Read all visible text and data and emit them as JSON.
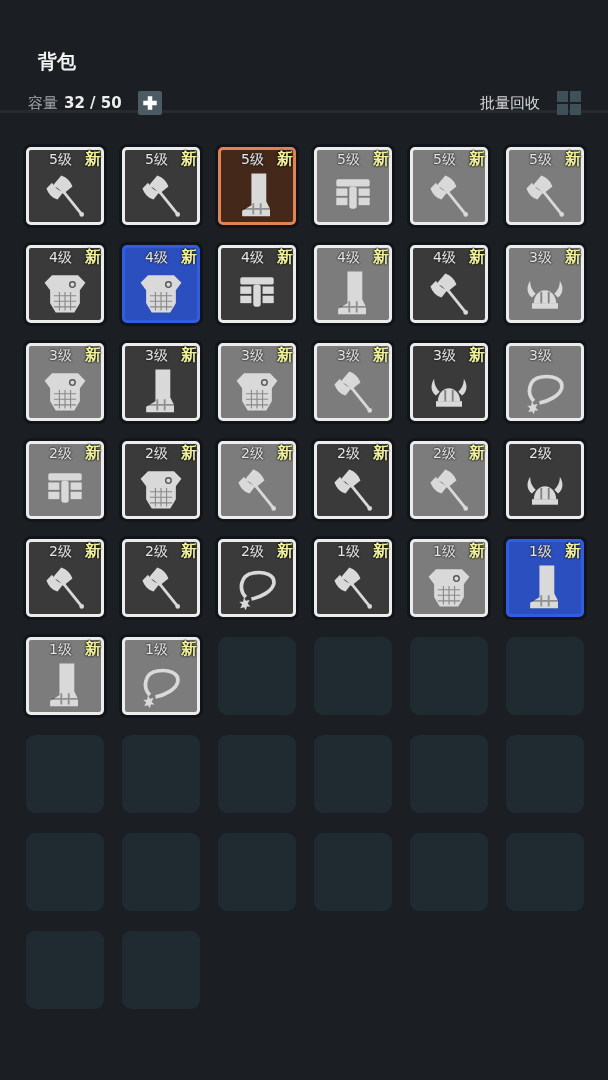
{
  "title": "背包",
  "capacity": {
    "label": "容量",
    "value": "32 / 50"
  },
  "batch_recycle": {
    "label": "批量回收"
  },
  "slots": [
    {
      "kind": "axe",
      "level": "5级",
      "badge": "新",
      "color": "#3a3a3b"
    },
    {
      "kind": "axe",
      "level": "5级",
      "badge": "新",
      "color": "#3a3a3b"
    },
    {
      "kind": "boot",
      "level": "5级",
      "badge": "新",
      "color": "#44281a"
    },
    {
      "kind": "greaves",
      "level": "5级",
      "badge": "新",
      "color": "#7c7c7c"
    },
    {
      "kind": "axe",
      "level": "5级",
      "badge": "新",
      "color": "#7c7c7c"
    },
    {
      "kind": "axe",
      "level": "5级",
      "badge": "新",
      "color": "#7c7c7c"
    },
    {
      "kind": "armor",
      "level": "4级",
      "badge": "新",
      "color": "#3a3a3b"
    },
    {
      "kind": "armor",
      "level": "4级",
      "badge": "新",
      "color": "#2b4fbe"
    },
    {
      "kind": "greaves",
      "level": "4级",
      "badge": "新",
      "color": "#3a3a3b"
    },
    {
      "kind": "boot",
      "level": "4级",
      "badge": "新",
      "color": "#7c7c7c"
    },
    {
      "kind": "axe",
      "level": "4级",
      "badge": "新",
      "color": "#3a3a3b"
    },
    {
      "kind": "helmet",
      "level": "3级",
      "badge": "新",
      "color": "#7c7c7c"
    },
    {
      "kind": "armor",
      "level": "3级",
      "badge": "新",
      "color": "#7c7c7c"
    },
    {
      "kind": "boot",
      "level": "3级",
      "badge": "新",
      "color": "#3a3a3b"
    },
    {
      "kind": "armor",
      "level": "3级",
      "badge": "新",
      "color": "#7c7c7c"
    },
    {
      "kind": "axe",
      "level": "3级",
      "badge": "新",
      "color": "#7c7c7c"
    },
    {
      "kind": "helmet",
      "level": "3级",
      "badge": "新",
      "color": "#3a3a3b"
    },
    {
      "kind": "necklace",
      "level": "3级",
      "color": "#7c7c7c"
    },
    {
      "kind": "greaves",
      "level": "2级",
      "badge": "新",
      "color": "#7c7c7c"
    },
    {
      "kind": "armor",
      "level": "2级",
      "badge": "新",
      "color": "#3a3a3b"
    },
    {
      "kind": "axe",
      "level": "2级",
      "badge": "新",
      "color": "#7c7c7c"
    },
    {
      "kind": "axe",
      "level": "2级",
      "badge": "新",
      "color": "#3a3a3b"
    },
    {
      "kind": "axe",
      "level": "2级",
      "badge": "新",
      "color": "#7c7c7c"
    },
    {
      "kind": "helmet",
      "level": "2级",
      "color": "#3a3a3b"
    },
    {
      "kind": "axe",
      "level": "2级",
      "badge": "新",
      "color": "#3a3a3b"
    },
    {
      "kind": "axe",
      "level": "2级",
      "badge": "新",
      "color": "#3a3a3b"
    },
    {
      "kind": "necklace",
      "level": "2级",
      "badge": "新",
      "color": "#3a3a3b"
    },
    {
      "kind": "axe",
      "level": "1级",
      "badge": "新",
      "color": "#3a3a3b"
    },
    {
      "kind": "armor",
      "level": "1级",
      "badge": "新",
      "color": "#7c7c7c"
    },
    {
      "kind": "boot",
      "level": "1级",
      "badge": "新",
      "color": "#2b4fbe"
    },
    {
      "kind": "boot",
      "level": "1级",
      "badge": "新",
      "color": "#7c7c7c"
    },
    {
      "kind": "necklace",
      "level": "1级",
      "badge": "新",
      "color": "#7c7c7c"
    },
    {
      "kind": "empty"
    },
    {
      "kind": "empty"
    },
    {
      "kind": "empty"
    },
    {
      "kind": "empty"
    },
    {
      "kind": "empty"
    },
    {
      "kind": "empty"
    },
    {
      "kind": "empty"
    },
    {
      "kind": "empty"
    },
    {
      "kind": "empty"
    },
    {
      "kind": "empty"
    },
    {
      "kind": "empty"
    },
    {
      "kind": "empty"
    },
    {
      "kind": "empty"
    },
    {
      "kind": "empty"
    },
    {
      "kind": "empty"
    },
    {
      "kind": "empty"
    },
    {
      "kind": "empty"
    },
    {
      "kind": "empty"
    }
  ]
}
